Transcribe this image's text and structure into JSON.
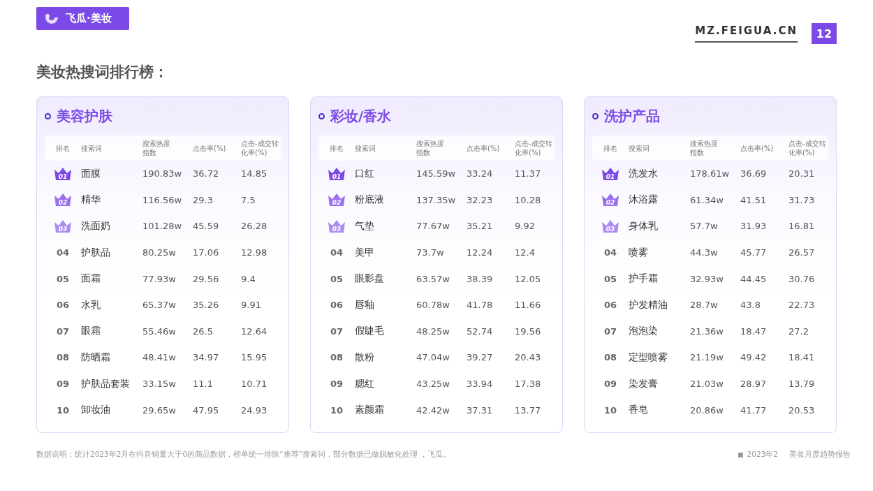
{
  "brand": {
    "name": "飞瓜·美妆"
  },
  "site": "MZ.FEIGUA.CN",
  "page_number": "12",
  "title": "美妆热搜词排行榜：",
  "panels": [
    {
      "title": "美容护肤",
      "columns": [
        "排名",
        "搜索词",
        "搜索热度指数",
        "点击率(%)",
        "点击-成交转化率(%)"
      ],
      "rows": [
        {
          "kind": "crown",
          "rank": "01",
          "term": "面膜",
          "index": "190.83w",
          "ctr": "36.72",
          "cvr": "14.85"
        },
        {
          "kind": "crown",
          "rank": "02",
          "term": "精华",
          "index": "116.56w",
          "ctr": "29.3",
          "cvr": "7.5"
        },
        {
          "kind": "crown",
          "rank": "03",
          "term": "洗面奶",
          "index": "101.28w",
          "ctr": "45.59",
          "cvr": "26.28"
        },
        {
          "kind": "plain",
          "rank": "04",
          "term": "护肤品",
          "index": "80.25w",
          "ctr": "17.06",
          "cvr": "12.98"
        },
        {
          "kind": "plain",
          "rank": "05",
          "term": "面霜",
          "index": "77.93w",
          "ctr": "29.56",
          "cvr": "9.4"
        },
        {
          "kind": "plain",
          "rank": "06",
          "term": "水乳",
          "index": "65.37w",
          "ctr": "35.26",
          "cvr": "9.91"
        },
        {
          "kind": "plain",
          "rank": "07",
          "term": "眼霜",
          "index": "55.46w",
          "ctr": "26.5",
          "cvr": "12.64"
        },
        {
          "kind": "plain",
          "rank": "08",
          "term": "防晒霜",
          "index": "48.41w",
          "ctr": "34.97",
          "cvr": "15.95"
        },
        {
          "kind": "plain",
          "rank": "09",
          "term": "护肤品套装",
          "index": "33.15w",
          "ctr": "11.1",
          "cvr": "10.71"
        },
        {
          "kind": "plain",
          "rank": "10",
          "term": "卸妆油",
          "index": "29.65w",
          "ctr": "47.95",
          "cvr": "24.93"
        }
      ]
    },
    {
      "title": "彩妆/香水",
      "columns": [
        "排名",
        "搜索词",
        "搜索热度指数",
        "点击率(%)",
        "点击-成交转化率(%)"
      ],
      "rows": [
        {
          "kind": "crown",
          "rank": "01",
          "term": "口红",
          "index": "145.59w",
          "ctr": "33.24",
          "cvr": "11.37"
        },
        {
          "kind": "crown",
          "rank": "02",
          "term": "粉底液",
          "index": "137.35w",
          "ctr": "32.23",
          "cvr": "10.28"
        },
        {
          "kind": "crown",
          "rank": "03",
          "term": "气垫",
          "index": "77.67w",
          "ctr": "35.21",
          "cvr": "9.92"
        },
        {
          "kind": "plain",
          "rank": "04",
          "term": "美甲",
          "index": "73.7w",
          "ctr": "12.24",
          "cvr": "12.4"
        },
        {
          "kind": "plain",
          "rank": "05",
          "term": "眼影盘",
          "index": "63.57w",
          "ctr": "38.39",
          "cvr": "12.05"
        },
        {
          "kind": "plain",
          "rank": "06",
          "term": "唇釉",
          "index": "60.78w",
          "ctr": "41.78",
          "cvr": "11.66"
        },
        {
          "kind": "plain",
          "rank": "07",
          "term": "假睫毛",
          "index": "48.25w",
          "ctr": "52.74",
          "cvr": "19.56"
        },
        {
          "kind": "plain",
          "rank": "08",
          "term": "散粉",
          "index": "47.04w",
          "ctr": "39.27",
          "cvr": "20.43"
        },
        {
          "kind": "plain",
          "rank": "09",
          "term": "腮红",
          "index": "43.25w",
          "ctr": "33.94",
          "cvr": "17.38"
        },
        {
          "kind": "plain",
          "rank": "10",
          "term": "素颜霜",
          "index": "42.42w",
          "ctr": "37.31",
          "cvr": "13.77"
        }
      ]
    },
    {
      "title": "洗护产品",
      "columns": [
        "排名",
        "搜索词",
        "搜索热度指数",
        "点击率(%)",
        "点击-成交转化率(%)"
      ],
      "rows": [
        {
          "kind": "crown",
          "rank": "01",
          "term": "洗发水",
          "index": "178.61w",
          "ctr": "36.69",
          "cvr": "20.31"
        },
        {
          "kind": "crown",
          "rank": "02",
          "term": "沐浴露",
          "index": "61.34w",
          "ctr": "41.51",
          "cvr": "31.73"
        },
        {
          "kind": "crown",
          "rank": "03",
          "term": "身体乳",
          "index": "57.7w",
          "ctr": "31.93",
          "cvr": "16.81"
        },
        {
          "kind": "plain",
          "rank": "04",
          "term": "喷雾",
          "index": "44.3w",
          "ctr": "45.77",
          "cvr": "26.57"
        },
        {
          "kind": "plain",
          "rank": "05",
          "term": "护手霜",
          "index": "32.93w",
          "ctr": "44.45",
          "cvr": "30.76"
        },
        {
          "kind": "plain",
          "rank": "06",
          "term": "护发精油",
          "index": "28.7w",
          "ctr": "43.8",
          "cvr": "22.73"
        },
        {
          "kind": "plain",
          "rank": "07",
          "term": "泡泡染",
          "index": "21.36w",
          "ctr": "18.47",
          "cvr": "27.2"
        },
        {
          "kind": "plain",
          "rank": "08",
          "term": "定型喷雾",
          "index": "21.19w",
          "ctr": "49.42",
          "cvr": "18.41"
        },
        {
          "kind": "plain",
          "rank": "09",
          "term": "染发膏",
          "index": "21.03w",
          "ctr": "28.97",
          "cvr": "13.79"
        },
        {
          "kind": "plain",
          "rank": "10",
          "term": "香皂",
          "index": "20.86w",
          "ctr": "41.77",
          "cvr": "20.53"
        }
      ]
    }
  ],
  "footnote": "数据说明：统计2023年2月在抖音销量大于0的商品数据，榜单统一排除“推荐”搜索词，部分数据已做脱敏化处理 ，飞瓜。",
  "footer": {
    "date": "2023年2",
    "report": "美妆月度趋势报告"
  }
}
